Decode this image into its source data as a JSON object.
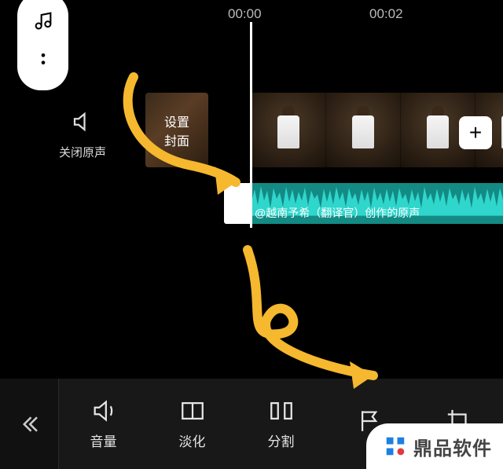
{
  "timestamps": {
    "a": "00:00",
    "b": "00:02"
  },
  "mute": {
    "label": "关闭原声"
  },
  "cover": {
    "label": "设置\n封面"
  },
  "add_clip": {
    "glyph": "+"
  },
  "audio": {
    "label": "@越南予希（翻译官）创作的原声"
  },
  "toolbar": {
    "volume": "音量",
    "fade": "淡化",
    "split": "分割",
    "flag": "",
    "crop": ""
  },
  "watermark": {
    "text": "鼎品软件"
  }
}
